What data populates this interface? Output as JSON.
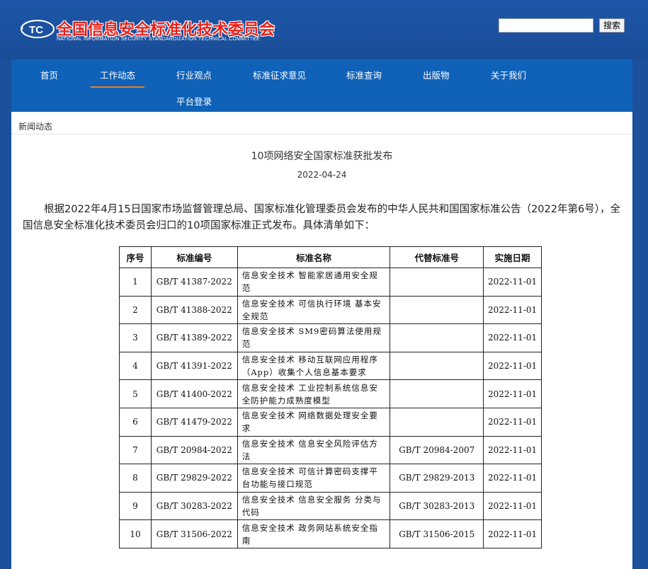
{
  "header": {
    "logo_title": "全国信息安全标准化技术委员会",
    "logo_subtitle": "NATIONAL INFORMATION SECURITY STANDARDIZATION TECHNICAL COMMITTEE",
    "logo_mark_text": "TC",
    "search_placeholder": "",
    "search_label": "搜索"
  },
  "nav": {
    "items": [
      "首页",
      "工作动态",
      "行业观点",
      "标准征求意见",
      "标准查询",
      "出版物",
      "关于我们",
      "平台登录"
    ],
    "active": "工作动态"
  },
  "breadcrumb": "新闻动态",
  "article": {
    "title": "10项网络安全国家标准获批发布",
    "date": "2022-04-24",
    "paragraph": "根据2022年4月15日国家市场监督管理总局、国家标准化管理委员会发布的中华人民共和国国家标准公告（2022年第6号），全国信息安全标准化技术委员会归口的10项国家标准正式发布。具体清单如下："
  },
  "table": {
    "headers": [
      "序号",
      "标准编号",
      "标准名称",
      "代替标准号",
      "实施日期"
    ],
    "rows": [
      [
        "1",
        "GB/T 41387-2022",
        "信息安全技术 智能家居通用安全规范",
        "",
        "2022-11-01"
      ],
      [
        "2",
        "GB/T 41388-2022",
        "信息安全技术 可信执行环境 基本安全规范",
        "",
        "2022-11-01"
      ],
      [
        "3",
        "GB/T 41389-2022",
        "信息安全技术 SM9密码算法使用规范",
        "",
        "2022-11-01"
      ],
      [
        "4",
        "GB/T 41391-2022",
        "信息安全技术 移动互联网应用程序（App）收集个人信息基本要求",
        "",
        "2022-11-01"
      ],
      [
        "5",
        "GB/T 41400-2022",
        "信息安全技术 工业控制系统信息安全防护能力成熟度模型",
        "",
        "2022-11-01"
      ],
      [
        "6",
        "GB/T 41479-2022",
        "信息安全技术 网络数据处理安全要求",
        "",
        "2022-11-01"
      ],
      [
        "7",
        "GB/T 20984-2022",
        "信息安全技术 信息安全风险评估方法",
        "GB/T 20984-2007",
        "2022-11-01"
      ],
      [
        "8",
        "GB/T 29829-2022",
        "信息安全技术 可信计算密码支撑平台功能与接口规范",
        "GB/T 29829-2013",
        "2022-11-01"
      ],
      [
        "9",
        "GB/T 30283-2022",
        "信息安全技术 信息安全服务 分类与代码",
        "GB/T 30283-2013",
        "2022-11-01"
      ],
      [
        "10",
        "GB/T 31506-2022",
        "信息安全技术 政务网站系统安全指南",
        "GB/T 31506-2015",
        "2022-11-01"
      ]
    ]
  }
}
